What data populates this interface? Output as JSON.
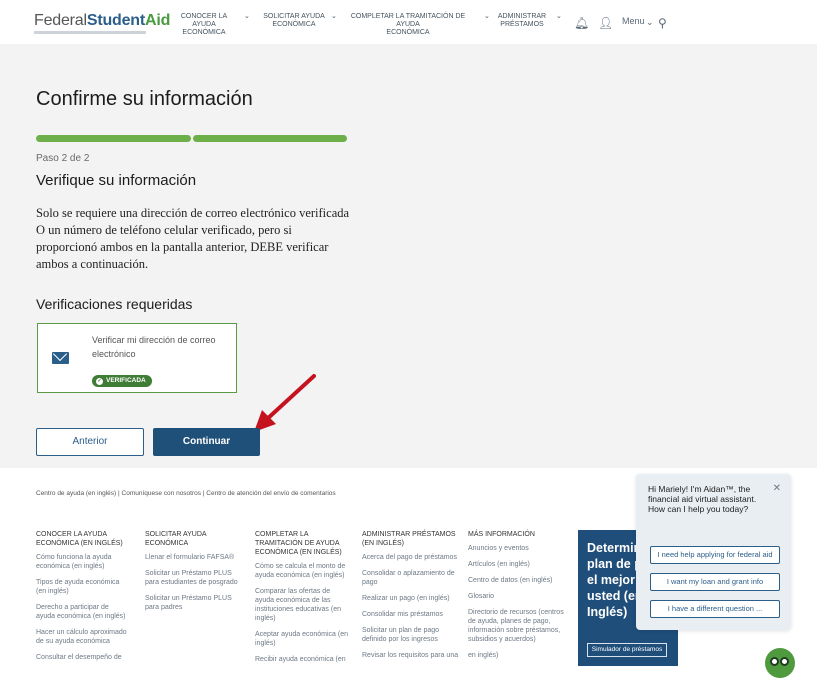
{
  "header": {
    "logo_federal": "Federal",
    "logo_student": "Student",
    "logo_aid": "Aid",
    "nav": [
      {
        "line1": "CONOCER LA AYUDA",
        "line2": "ECONÓMICA"
      },
      {
        "line1": "SOLICITAR AYUDA",
        "line2": "ECONÓMICA"
      },
      {
        "line1": "COMPLETAR LA TRAMITACIÓN DE AYUDA",
        "line2": "ECONÓMICA"
      },
      {
        "line1": "ADMINISTRAR",
        "line2": "PRÉSTAMOS"
      }
    ],
    "menu_label": "Menu"
  },
  "main": {
    "title": "Confirme su información",
    "progress": {
      "current": 2,
      "total": 2
    },
    "step": "Paso 2 de 2",
    "subtitle": "Verifique su información",
    "paragraph": "Solo se requiere una dirección de correo electrónico verificada O un número de teléfono celular verificado, pero si proporcionó ambos en la pantalla anterior, DEBE verificar ambos a continuación.",
    "required_heading": "Verificaciones requeridas",
    "card": {
      "text": "Verificar mi dirección de correo electrónico",
      "badge": "VERIFICADA"
    },
    "btn_prev": "Anterior",
    "btn_next": "Continuar"
  },
  "footer": {
    "links": "Centro de ayuda (en inglés) | Comuníquese con nosotros | Centro de atención del envío de comentarios",
    "columns": [
      {
        "heading": "CONOCER LA AYUDA ECONÓMICA (EN INGLÉS)",
        "links": [
          "Cómo funciona la ayuda económica (en inglés)",
          "Tipos de ayuda económica (en inglés)",
          "Derecho a participar de ayuda económica (en inglés)",
          "Hacer un cálculo aproximado de su ayuda económica",
          "Consultar el desempeño de"
        ]
      },
      {
        "heading": "SOLICITAR AYUDA ECONÓMICA",
        "links": [
          "Llenar el formulario FAFSA®",
          "Solicitar un Préstamo PLUS para estudiantes de posgrado",
          "Solicitar un Préstamo PLUS para padres"
        ]
      },
      {
        "heading": "COMPLETAR LA TRAMITACIÓN DE AYUDA ECONÓMICA (EN INGLÉS)",
        "links": [
          "Cómo se calcula el monto de ayuda económica (en inglés)",
          "Comparar las ofertas de ayuda económica de las instituciones educativas (en inglés)",
          "Aceptar ayuda económica (en inglés)",
          "Recibir ayuda económica (en"
        ]
      },
      {
        "heading": "ADMINISTRAR PRÉSTAMOS (EN INGLÉS)",
        "links": [
          "Acerca del pago de préstamos",
          "Consolidar o aplazamiento de pago",
          "Realizar un pago (en inglés)",
          "Consolidar mis préstamos",
          "Solicitar un plan de pago definido por los ingresos",
          "Revisar los requisitos para una"
        ]
      },
      {
        "heading": "MÁS INFORMACIÓN",
        "links": [
          "Anuncios y eventos",
          "Artículos (en inglés)",
          "Centro de datos (en inglés)",
          "Glosario",
          "Directorio de recursos (centros de ayuda, planes de pago, información sobre préstamos, subsidios y acuerdos)",
          "en inglés)"
        ]
      }
    ],
    "promo": {
      "title": "Determina el plan de pago el mejor para usted (en Inglés)",
      "button": "Simulador de préstamos"
    }
  },
  "chat": {
    "message": "Hi Mariely! I'm Aidan™, the financial aid virtual assistant. How can I help you today?",
    "options": [
      "I need help applying for federal aid",
      "I want my loan and grant info",
      "I have a different question ..."
    ]
  }
}
